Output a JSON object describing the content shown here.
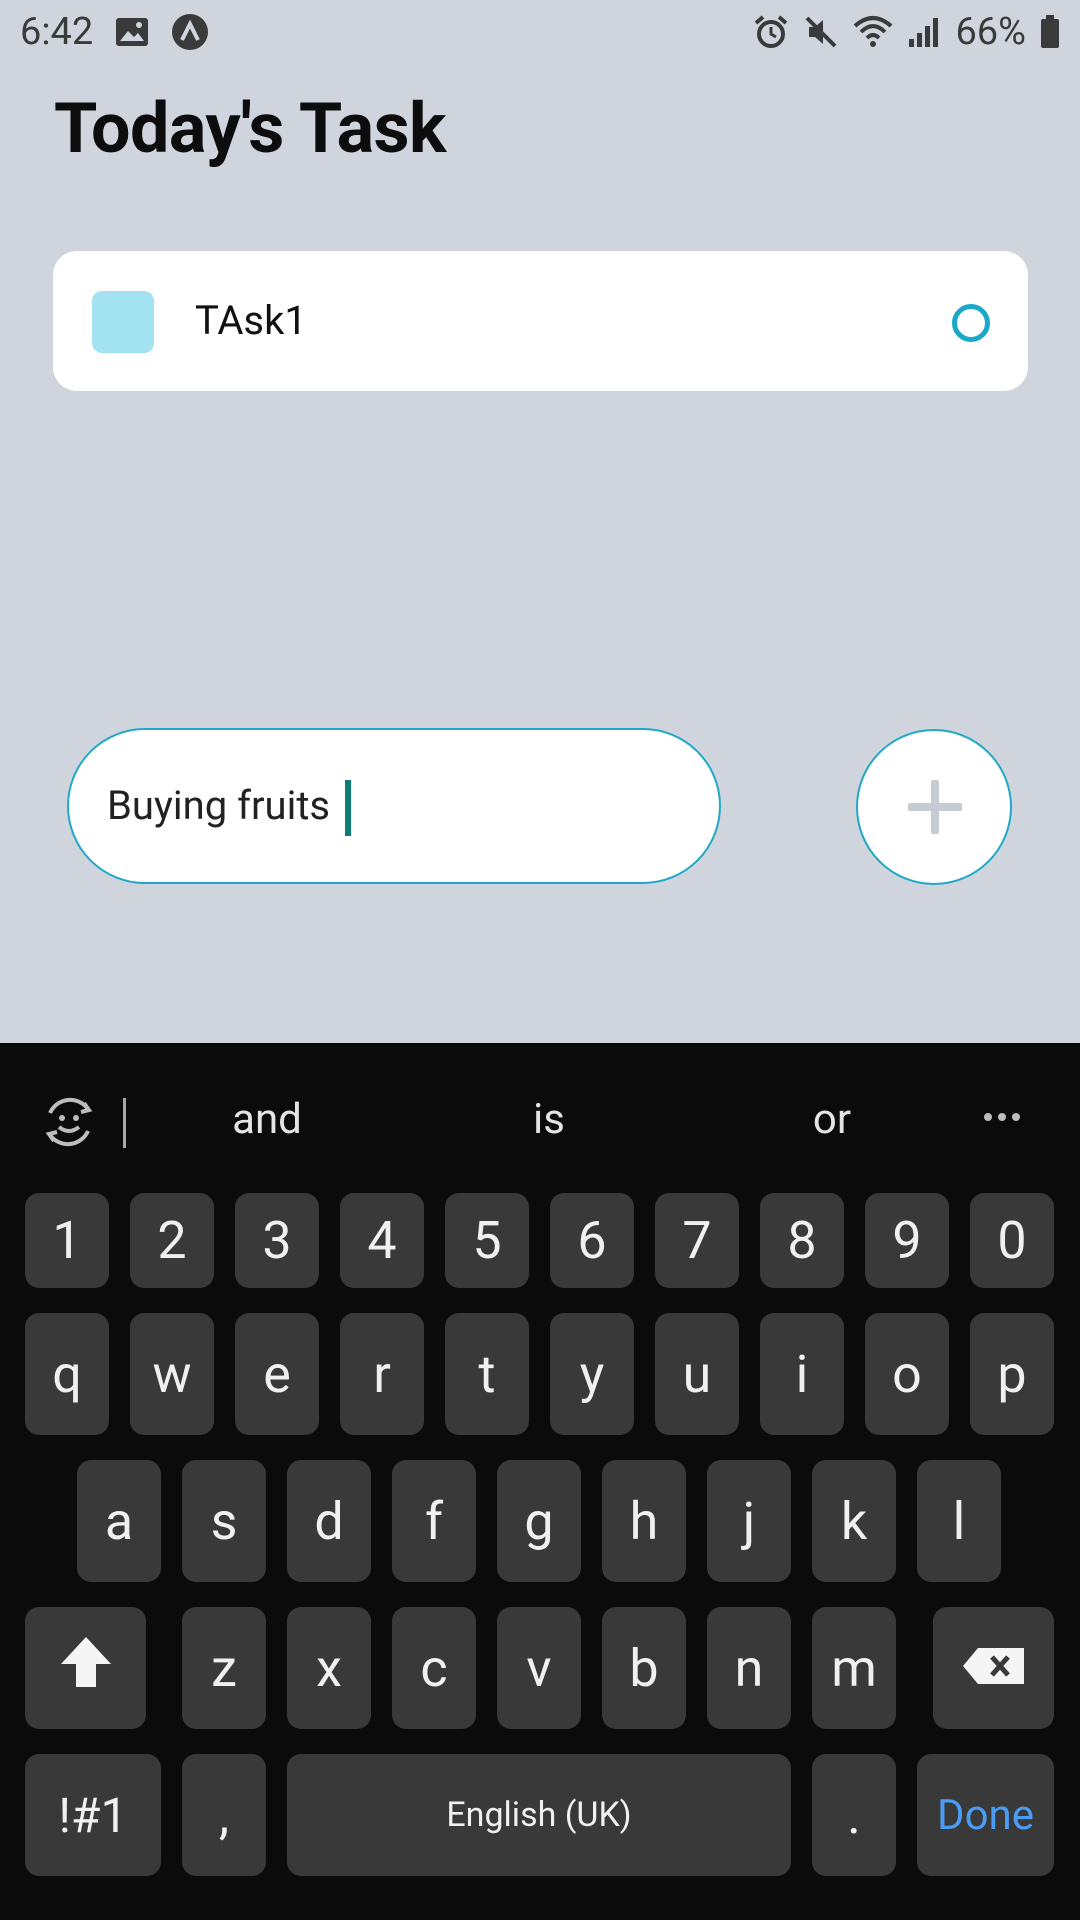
{
  "status_bar": {
    "time": "6:42",
    "battery": "66%"
  },
  "app": {
    "title": "Today's Task",
    "tasks": [
      {
        "label": "TAsk1",
        "color": "#a3e2f0"
      }
    ],
    "input": {
      "value": "Buying fruits"
    },
    "accent_color": "#20a9c7"
  },
  "keyboard": {
    "suggestions": [
      "and",
      "is",
      "or"
    ],
    "rows": {
      "numbers": [
        "1",
        "2",
        "3",
        "4",
        "5",
        "6",
        "7",
        "8",
        "9",
        "0"
      ],
      "row1": [
        "q",
        "w",
        "e",
        "r",
        "t",
        "y",
        "u",
        "i",
        "o",
        "p"
      ],
      "row2": [
        "a",
        "s",
        "d",
        "f",
        "g",
        "h",
        "j",
        "k",
        "l"
      ],
      "row3": [
        "z",
        "x",
        "c",
        "v",
        "b",
        "n",
        "m"
      ]
    },
    "symbols_label": "!#1",
    "comma_label": ",",
    "space_label": "English (UK)",
    "period_label": ".",
    "done_label": "Done"
  }
}
